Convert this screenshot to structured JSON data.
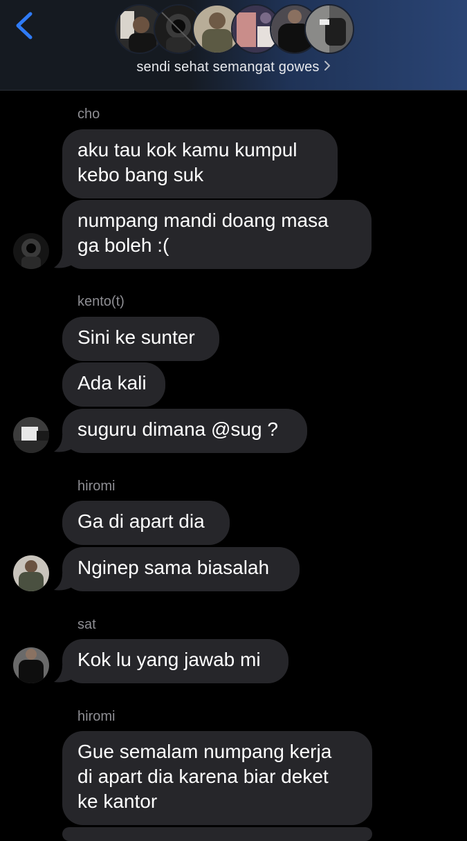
{
  "header": {
    "group_name": "sendi sehat semangat gowes",
    "back_icon": "chevron-left-icon",
    "accent_color": "#2f7bf6"
  },
  "messages": [
    {
      "sender": "cho",
      "bubbles": [
        "aku tau kok kamu kumpul\nkebo bang suk",
        "numpang mandi doang masa\nga boleh :("
      ]
    },
    {
      "sender": "kento(t)",
      "bubbles": [
        "Sini ke sunter",
        "Ada kali",
        "suguru dimana @sug ?"
      ]
    },
    {
      "sender": "hiromi",
      "bubbles": [
        "Ga di apart dia",
        "Nginep sama biasalah"
      ]
    },
    {
      "sender": "sat",
      "bubbles": [
        "Kok lu yang jawab mi"
      ]
    },
    {
      "sender": "hiromi",
      "bubbles": [
        "Gue semalam numpang kerja\ndi apart dia karena biar deket\nke kantor"
      ]
    }
  ]
}
